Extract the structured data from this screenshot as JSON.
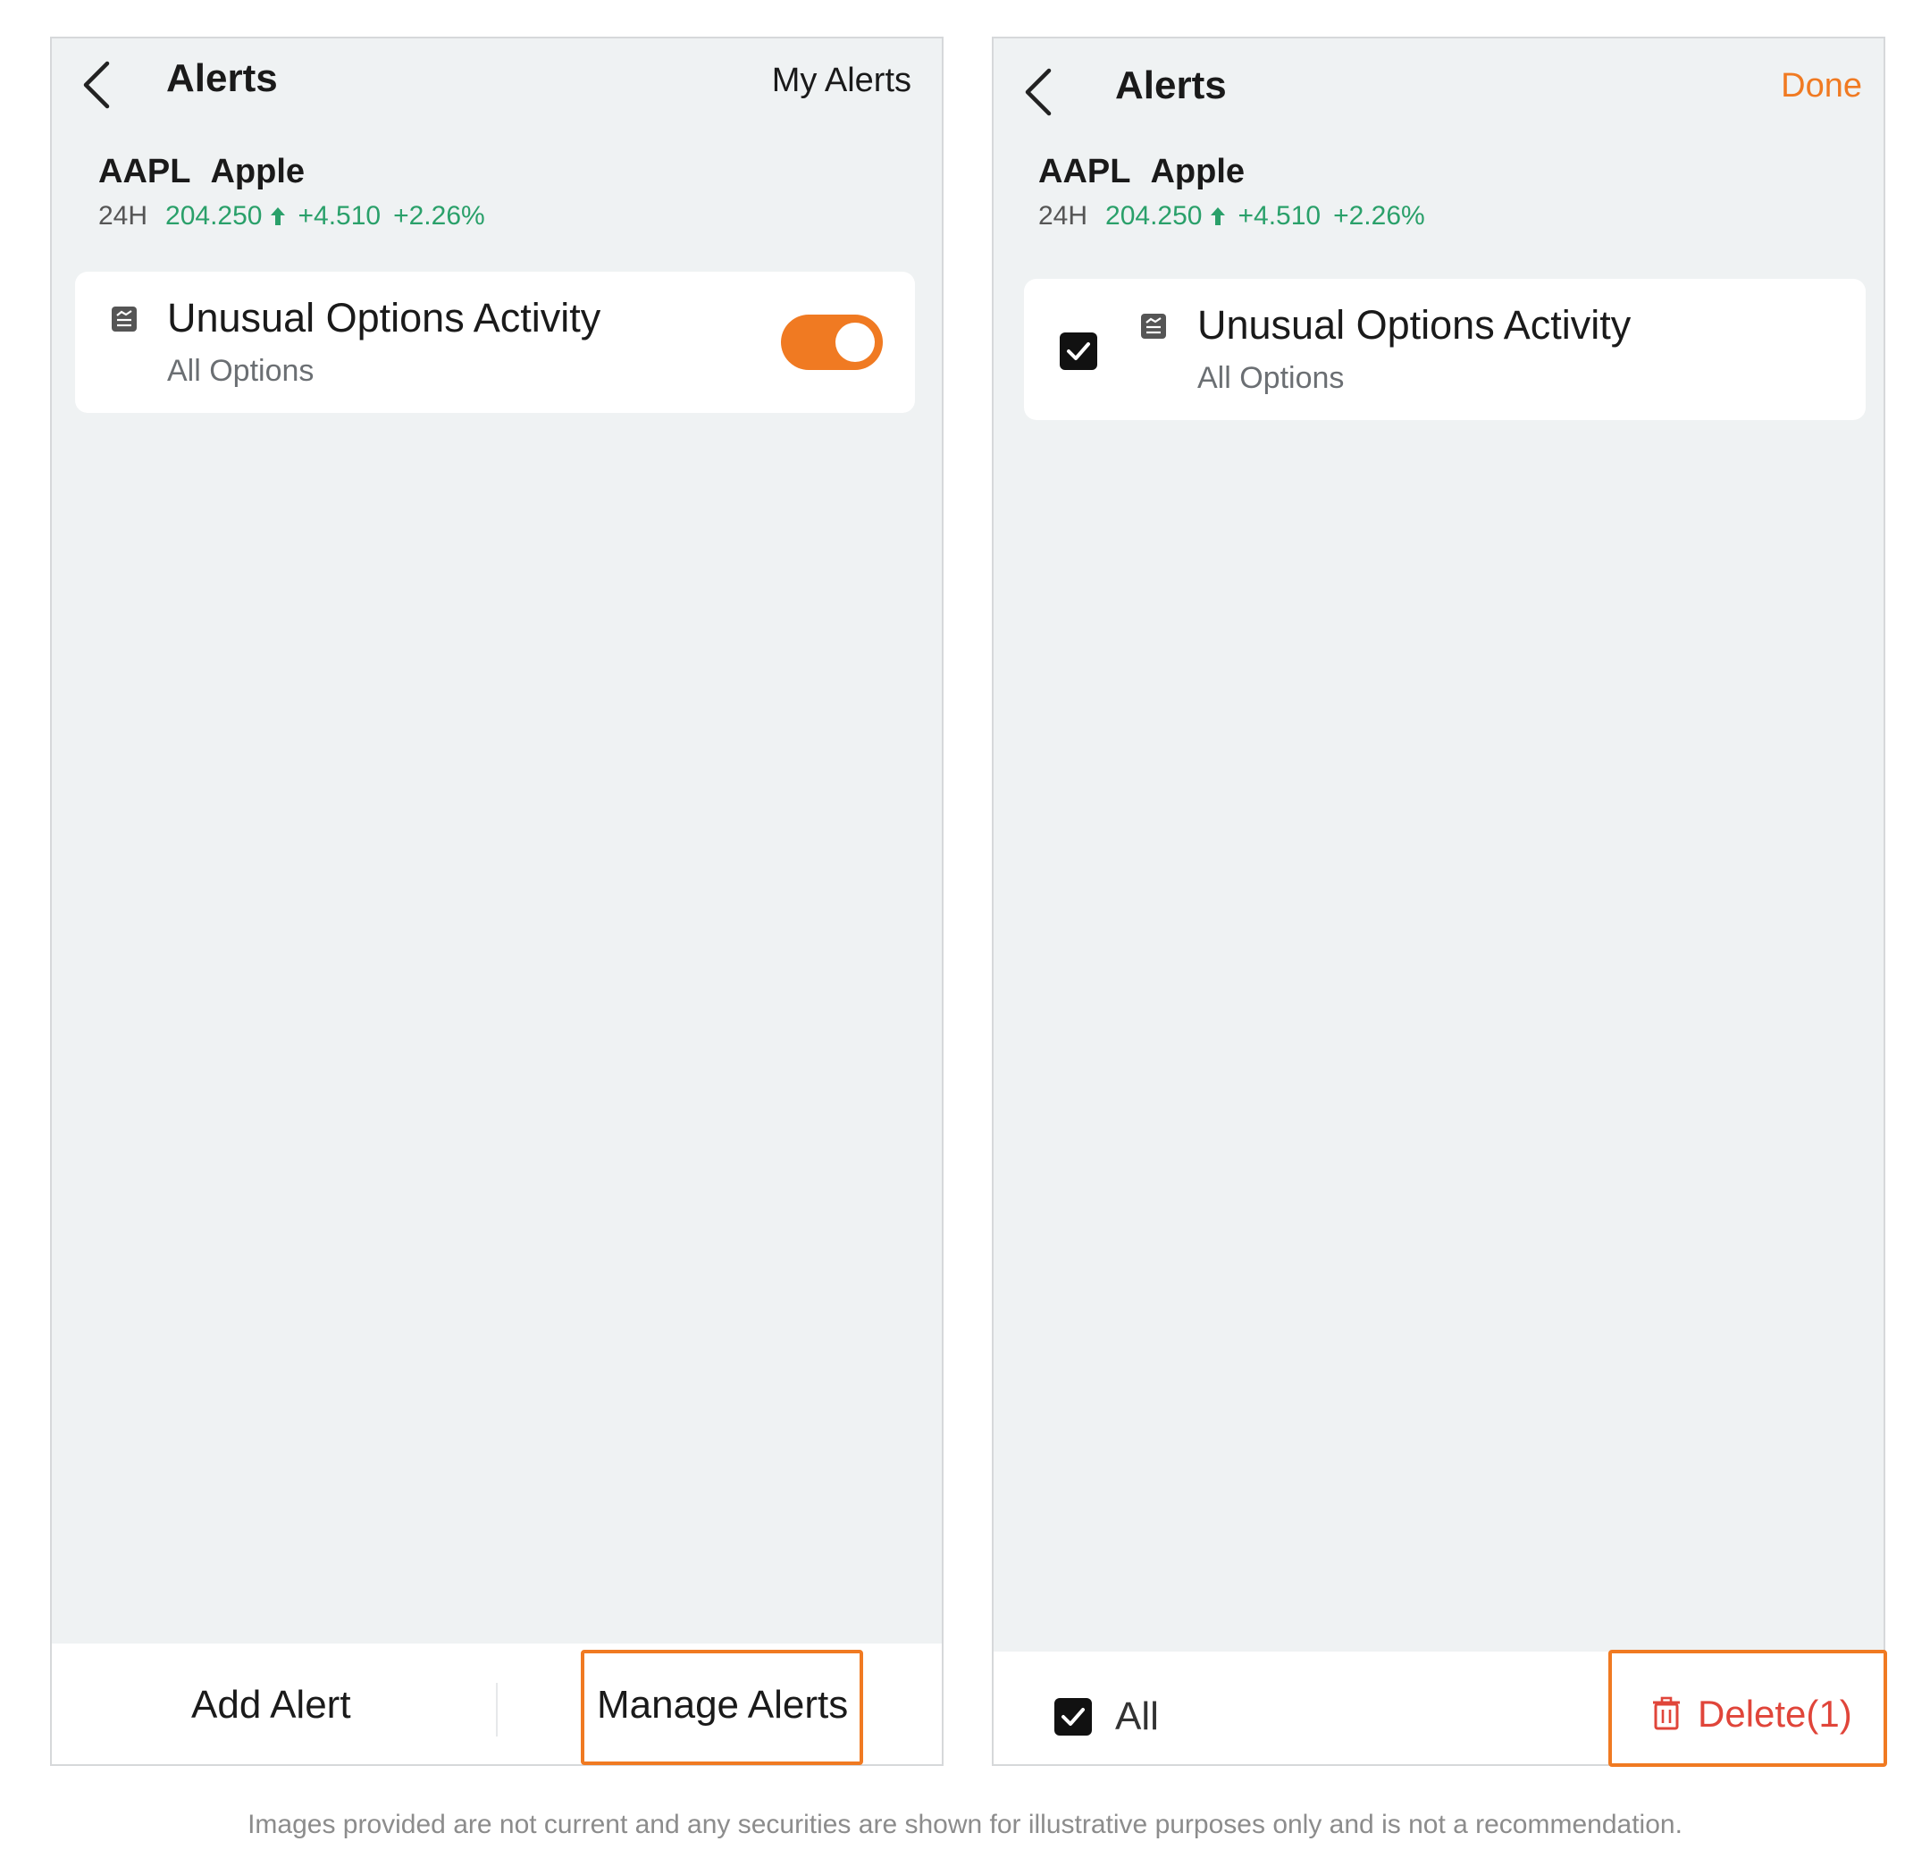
{
  "left_screen": {
    "title": "Alerts",
    "header_action": "My Alerts",
    "stock": {
      "symbol": "AAPL",
      "name": "Apple",
      "period": "24H",
      "price": "204.250",
      "change": "+4.510",
      "change_pct": "+2.26%"
    },
    "alert": {
      "title": "Unusual Options Activity",
      "subtitle": "All Options",
      "enabled": true
    },
    "bottom": {
      "add_label": "Add Alert",
      "manage_label": "Manage Alerts"
    }
  },
  "right_screen": {
    "title": "Alerts",
    "header_action": "Done",
    "stock": {
      "symbol": "AAPL",
      "name": "Apple",
      "period": "24H",
      "price": "204.250",
      "change": "+4.510",
      "change_pct": "+2.26%"
    },
    "alert": {
      "title": "Unusual Options Activity",
      "subtitle": "All Options",
      "checked": true
    },
    "bottom": {
      "all_label": "All",
      "delete_label": "Delete(1)"
    }
  },
  "disclaimer": "Images provided are not current and any securities are shown for illustrative purposes only and is not a recommendation.",
  "colors": {
    "accent": "#f07a22",
    "positive": "#2aa06a",
    "danger": "#e0453a",
    "background": "#eff2f3"
  },
  "icons": [
    "back-arrow-icon",
    "up-arrow-icon",
    "options-activity-icon",
    "checkmark-icon",
    "trash-icon"
  ]
}
